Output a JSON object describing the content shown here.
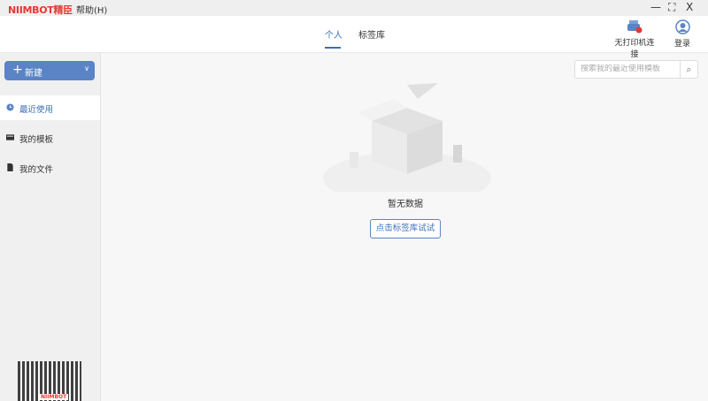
{
  "titlebar": {
    "logo": "NIIMBOT精臣",
    "menu_help": "帮助(H)",
    "minimize": "—",
    "maximize": "⛶",
    "close": "X"
  },
  "header": {
    "tabs": [
      {
        "label": "个人",
        "active": true
      },
      {
        "label": "标签库",
        "active": false
      }
    ],
    "printer_status": "无打印机连接",
    "login": "登录"
  },
  "sidebar": {
    "new_button": "新建",
    "items": [
      {
        "label": "最近使用",
        "active": true
      },
      {
        "label": "我的模板"
      },
      {
        "label": "我的文件"
      }
    ],
    "qr_label": "NIIMBOT"
  },
  "main": {
    "search_placeholder": "搜索我的最近使用模板",
    "empty_text": "暂无数据",
    "try_button": "点击标签库试试"
  },
  "colors": {
    "accent": "#3d6fb5",
    "brand": "#e53935",
    "button": "#5a84c5"
  }
}
